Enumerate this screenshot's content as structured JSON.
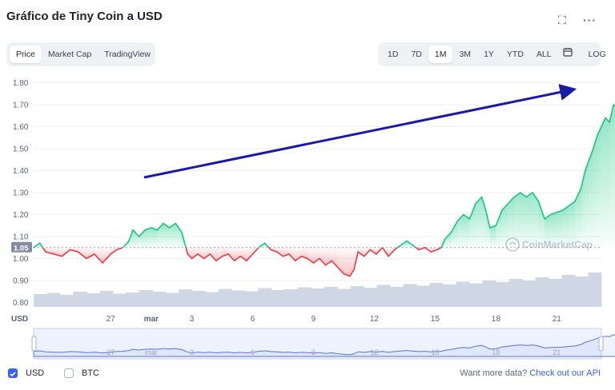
{
  "title": "Gráfico de Tiny Coin a USD",
  "icons": {
    "fullscreen": "fullscreen-icon",
    "more": "more-options-icon",
    "calendar": "calendar-icon"
  },
  "chart_tabs": [
    {
      "label": "Price",
      "active": true
    },
    {
      "label": "Market Cap",
      "active": false
    },
    {
      "label": "TradingView",
      "active": false
    }
  ],
  "ranges": [
    {
      "label": "1D",
      "active": false
    },
    {
      "label": "7D",
      "active": false
    },
    {
      "label": "1M",
      "active": true
    },
    {
      "label": "3M",
      "active": false
    },
    {
      "label": "1Y",
      "active": false
    },
    {
      "label": "YTD",
      "active": false
    },
    {
      "label": "ALL",
      "active": false
    }
  ],
  "log_label": "LOG",
  "watermark": "CoinMarketCap",
  "colors": {
    "up": "#16c784",
    "down": "#ea3943",
    "volume": "#cfd6e4",
    "accent": "#3861fb",
    "arrow": "#1a1aa8"
  },
  "footer": {
    "usd_label": "USD",
    "btc_label": "BTC",
    "more_data": "Want more data?",
    "api_link": "Check out our API"
  },
  "chart_data": {
    "type": "line",
    "x_unit": "day",
    "y_ticks": [
      "1.80",
      "1.70",
      "1.60",
      "1.50",
      "1.40",
      "1.30",
      "1.20",
      "1.10",
      "1.00",
      "0.90",
      "0.80"
    ],
    "y_range": [
      0.78,
      1.82
    ],
    "current_price_label": "1.05",
    "baseline": 1.05,
    "x_ticks": [
      {
        "label": "27",
        "day": 27
      },
      {
        "label": "mar",
        "day": 29
      },
      {
        "label": "3",
        "day": 31
      },
      {
        "label": "6",
        "day": 34
      },
      {
        "label": "9",
        "day": 37
      },
      {
        "label": "12",
        "day": 40
      },
      {
        "label": "15",
        "day": 43
      },
      {
        "label": "18",
        "day": 46
      },
      {
        "label": "21",
        "day": 49
      }
    ],
    "x_range": [
      23.2,
      51.2
    ],
    "y_axis_label": "USD",
    "price": [
      [
        23.2,
        1.05
      ],
      [
        23.5,
        1.07
      ],
      [
        23.8,
        1.03
      ],
      [
        24.2,
        1.02
      ],
      [
        24.6,
        1.01
      ],
      [
        25.0,
        1.04
      ],
      [
        25.4,
        1.03
      ],
      [
        25.8,
        1.0
      ],
      [
        26.2,
        1.02
      ],
      [
        26.6,
        0.98
      ],
      [
        27.0,
        1.02
      ],
      [
        27.3,
        1.04
      ],
      [
        27.6,
        1.05
      ],
      [
        27.9,
        1.08
      ],
      [
        28.1,
        1.13
      ],
      [
        28.4,
        1.1
      ],
      [
        28.7,
        1.13
      ],
      [
        29.0,
        1.14
      ],
      [
        29.3,
        1.13
      ],
      [
        29.6,
        1.16
      ],
      [
        29.9,
        1.14
      ],
      [
        30.2,
        1.16
      ],
      [
        30.5,
        1.12
      ],
      [
        30.8,
        1.02
      ],
      [
        31.0,
        1.0
      ],
      [
        31.3,
        1.02
      ],
      [
        31.6,
        1.0
      ],
      [
        31.9,
        1.02
      ],
      [
        32.2,
        0.99
      ],
      [
        32.5,
        1.01
      ],
      [
        32.8,
        1.02
      ],
      [
        33.1,
        0.99
      ],
      [
        33.4,
        1.01
      ],
      [
        33.7,
        0.99
      ],
      [
        34.0,
        1.02
      ],
      [
        34.3,
        1.05
      ],
      [
        34.6,
        1.07
      ],
      [
        34.9,
        1.04
      ],
      [
        35.2,
        1.03
      ],
      [
        35.5,
        1.01
      ],
      [
        35.8,
        1.02
      ],
      [
        36.1,
        0.99
      ],
      [
        36.4,
        1.01
      ],
      [
        36.7,
        1.0
      ],
      [
        37.0,
        0.98
      ],
      [
        37.3,
        1.0
      ],
      [
        37.6,
        0.97
      ],
      [
        37.9,
        0.99
      ],
      [
        38.2,
        0.96
      ],
      [
        38.5,
        0.93
      ],
      [
        38.8,
        0.92
      ],
      [
        39.0,
        0.95
      ],
      [
        39.2,
        1.03
      ],
      [
        39.5,
        1.01
      ],
      [
        39.8,
        1.04
      ],
      [
        40.1,
        1.02
      ],
      [
        40.4,
        1.05
      ],
      [
        40.7,
        1.01
      ],
      [
        41.0,
        1.04
      ],
      [
        41.3,
        1.06
      ],
      [
        41.6,
        1.08
      ],
      [
        41.9,
        1.06
      ],
      [
        42.2,
        1.04
      ],
      [
        42.5,
        1.05
      ],
      [
        42.8,
        1.03
      ],
      [
        43.1,
        1.04
      ],
      [
        43.3,
        1.05
      ],
      [
        43.5,
        1.09
      ],
      [
        43.8,
        1.12
      ],
      [
        44.1,
        1.17
      ],
      [
        44.4,
        1.2
      ],
      [
        44.7,
        1.18
      ],
      [
        45.0,
        1.25
      ],
      [
        45.3,
        1.28
      ],
      [
        45.5,
        1.22
      ],
      [
        45.7,
        1.14
      ],
      [
        46.0,
        1.15
      ],
      [
        46.3,
        1.22
      ],
      [
        46.6,
        1.25
      ],
      [
        46.9,
        1.28
      ],
      [
        47.2,
        1.3
      ],
      [
        47.5,
        1.28
      ],
      [
        47.8,
        1.3
      ],
      [
        48.1,
        1.26
      ],
      [
        48.4,
        1.18
      ],
      [
        48.7,
        1.2
      ],
      [
        49.0,
        1.21
      ],
      [
        49.3,
        1.22
      ],
      [
        49.6,
        1.24
      ],
      [
        49.9,
        1.26
      ],
      [
        50.2,
        1.32
      ],
      [
        50.4,
        1.4
      ],
      [
        50.6,
        1.45
      ],
      [
        50.8,
        1.5
      ],
      [
        51.0,
        1.56
      ],
      [
        51.2,
        1.6
      ],
      [
        51.4,
        1.64
      ],
      [
        51.6,
        1.62
      ],
      [
        51.8,
        1.7
      ],
      [
        52.0,
        1.68
      ],
      [
        52.2,
        1.76
      ],
      [
        52.4,
        1.72
      ],
      [
        52.6,
        1.77
      ],
      [
        52.8,
        1.7
      ],
      [
        53.0,
        1.69
      ]
    ],
    "volume": [
      0.32,
      0.35,
      0.3,
      0.38,
      0.34,
      0.4,
      0.33,
      0.36,
      0.42,
      0.38,
      0.35,
      0.44,
      0.4,
      0.37,
      0.45,
      0.41,
      0.39,
      0.47,
      0.42,
      0.44,
      0.49,
      0.46,
      0.5,
      0.45,
      0.52,
      0.48,
      0.55,
      0.5,
      0.57,
      0.53,
      0.6,
      0.56,
      0.63,
      0.59,
      0.66,
      0.62,
      0.7,
      0.66,
      0.74,
      0.7,
      0.8,
      0.76,
      0.86
    ]
  }
}
